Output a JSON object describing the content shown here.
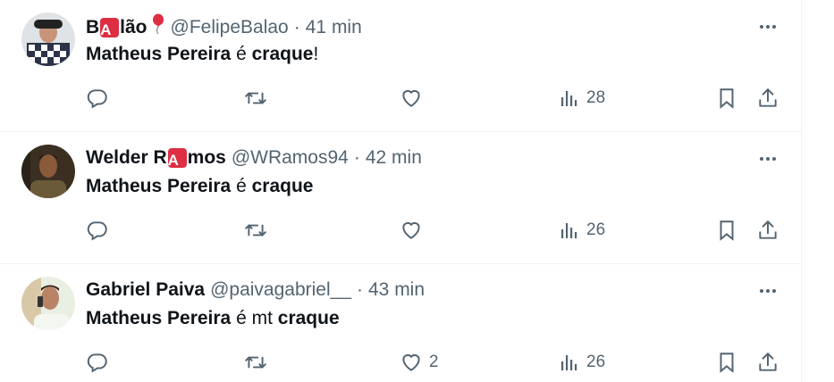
{
  "tweets": [
    {
      "name_parts": [
        "B",
        "A",
        "lão"
      ],
      "handle": "@FelipeBalao",
      "separator": "·",
      "time": "41 min",
      "text": [
        {
          "t": "Matheus Pereira",
          "bold": true
        },
        {
          "t": " é ",
          "bold": false
        },
        {
          "t": "craque",
          "bold": true
        },
        {
          "t": "!",
          "bold": false
        }
      ],
      "reply_count": "",
      "retweet_count": "",
      "like_count": "",
      "view_count": "28",
      "has_balloon": true
    },
    {
      "name_parts": [
        "Welder R",
        "A",
        "mos"
      ],
      "handle": "@WRamos94",
      "separator": "·",
      "time": "42 min",
      "text": [
        {
          "t": "Matheus Pereira",
          "bold": true
        },
        {
          "t": " é ",
          "bold": false
        },
        {
          "t": "craque",
          "bold": true
        }
      ],
      "reply_count": "",
      "retweet_count": "",
      "like_count": "",
      "view_count": "26",
      "has_balloon": false
    },
    {
      "name_parts": [
        "Gabriel Paiva"
      ],
      "handle": "@paivagabriel__",
      "separator": "·",
      "time": "43 min",
      "text": [
        {
          "t": "Matheus Pereira",
          "bold": true
        },
        {
          "t": " é mt ",
          "bold": false
        },
        {
          "t": "craque",
          "bold": true
        }
      ],
      "reply_count": "",
      "retweet_count": "",
      "like_count": "2",
      "view_count": "26",
      "has_balloon": false
    }
  ],
  "icons": {
    "reply": "reply-icon",
    "retweet": "retweet-icon",
    "like": "heart-icon",
    "views": "views-icon",
    "bookmark": "bookmark-icon",
    "share": "share-icon",
    "more": "more-icon"
  },
  "colors": {
    "text": "#0f1419",
    "secondary": "#536471",
    "badge": "#dd2e44",
    "divider": "#eff3f4"
  }
}
